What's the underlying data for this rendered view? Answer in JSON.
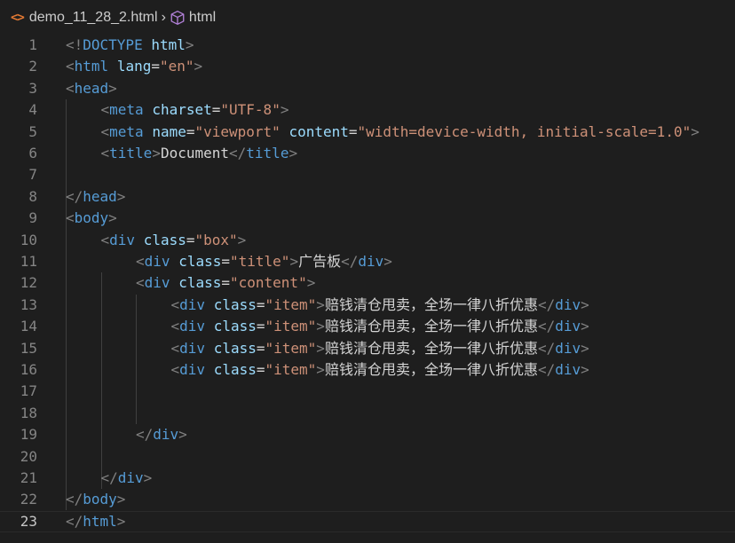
{
  "breadcrumb": {
    "file_name": "demo_11_28_2.html",
    "node": "html",
    "file_icon_glyph": "<>",
    "separator_glyph": "›"
  },
  "editor": {
    "current_line": 23,
    "lines": [
      {
        "n": "1",
        "indent": 0,
        "tokens": [
          [
            "punct",
            "<!"
          ],
          [
            "doctype",
            "DOCTYPE"
          ],
          [
            "text",
            " "
          ],
          [
            "doctype-name",
            "html"
          ],
          [
            "punct",
            ">"
          ]
        ]
      },
      {
        "n": "2",
        "indent": 0,
        "tokens": [
          [
            "punct",
            "<"
          ],
          [
            "tag",
            "html"
          ],
          [
            "text",
            " "
          ],
          [
            "attr",
            "lang"
          ],
          [
            "eq",
            "="
          ],
          [
            "str",
            "\"en\""
          ],
          [
            "punct",
            ">"
          ]
        ]
      },
      {
        "n": "3",
        "indent": 0,
        "tokens": [
          [
            "punct",
            "<"
          ],
          [
            "tag",
            "head"
          ],
          [
            "punct",
            ">"
          ]
        ]
      },
      {
        "n": "4",
        "indent": 1,
        "tokens": [
          [
            "punct",
            "<"
          ],
          [
            "tag",
            "meta"
          ],
          [
            "text",
            " "
          ],
          [
            "attr",
            "charset"
          ],
          [
            "eq",
            "="
          ],
          [
            "str",
            "\"UTF-8\""
          ],
          [
            "punct",
            ">"
          ]
        ]
      },
      {
        "n": "5",
        "indent": 1,
        "tokens": [
          [
            "punct",
            "<"
          ],
          [
            "tag",
            "meta"
          ],
          [
            "text",
            " "
          ],
          [
            "attr",
            "name"
          ],
          [
            "eq",
            "="
          ],
          [
            "str",
            "\"viewport\""
          ],
          [
            "text",
            " "
          ],
          [
            "attr",
            "content"
          ],
          [
            "eq",
            "="
          ],
          [
            "str",
            "\"width=device-width, initial-scale=1.0\""
          ],
          [
            "punct",
            ">"
          ]
        ]
      },
      {
        "n": "6",
        "indent": 1,
        "tokens": [
          [
            "punct",
            "<"
          ],
          [
            "tag",
            "title"
          ],
          [
            "punct",
            ">"
          ],
          [
            "text",
            "Document"
          ],
          [
            "punct",
            "</"
          ],
          [
            "tag",
            "title"
          ],
          [
            "punct",
            ">"
          ]
        ]
      },
      {
        "n": "7",
        "indent": 0,
        "tokens": []
      },
      {
        "n": "8",
        "indent": 0,
        "tokens": [
          [
            "punct",
            "</"
          ],
          [
            "tag",
            "head"
          ],
          [
            "punct",
            ">"
          ]
        ]
      },
      {
        "n": "9",
        "indent": 0,
        "tokens": [
          [
            "punct",
            "<"
          ],
          [
            "tag",
            "body"
          ],
          [
            "punct",
            ">"
          ]
        ]
      },
      {
        "n": "10",
        "indent": 1,
        "tokens": [
          [
            "punct",
            "<"
          ],
          [
            "tag",
            "div"
          ],
          [
            "text",
            " "
          ],
          [
            "attr",
            "class"
          ],
          [
            "eq",
            "="
          ],
          [
            "str",
            "\"box\""
          ],
          [
            "punct",
            ">"
          ]
        ]
      },
      {
        "n": "11",
        "indent": 2,
        "tokens": [
          [
            "punct",
            "<"
          ],
          [
            "tag",
            "div"
          ],
          [
            "text",
            " "
          ],
          [
            "attr",
            "class"
          ],
          [
            "eq",
            "="
          ],
          [
            "str",
            "\"title\""
          ],
          [
            "punct",
            ">"
          ],
          [
            "text",
            "广告板"
          ],
          [
            "punct",
            "</"
          ],
          [
            "tag",
            "div"
          ],
          [
            "punct",
            ">"
          ]
        ]
      },
      {
        "n": "12",
        "indent": 2,
        "tokens": [
          [
            "punct",
            "<"
          ],
          [
            "tag",
            "div"
          ],
          [
            "text",
            " "
          ],
          [
            "attr",
            "class"
          ],
          [
            "eq",
            "="
          ],
          [
            "str",
            "\"content\""
          ],
          [
            "punct",
            ">"
          ]
        ]
      },
      {
        "n": "13",
        "indent": 3,
        "tokens": [
          [
            "punct",
            "<"
          ],
          [
            "tag",
            "div"
          ],
          [
            "text",
            " "
          ],
          [
            "attr",
            "class"
          ],
          [
            "eq",
            "="
          ],
          [
            "str",
            "\"item\""
          ],
          [
            "punct",
            ">"
          ],
          [
            "text",
            "赔钱清仓甩卖，全场一律八折优惠"
          ],
          [
            "punct",
            "</"
          ],
          [
            "tag",
            "div"
          ],
          [
            "punct",
            ">"
          ]
        ]
      },
      {
        "n": "14",
        "indent": 3,
        "tokens": [
          [
            "punct",
            "<"
          ],
          [
            "tag",
            "div"
          ],
          [
            "text",
            " "
          ],
          [
            "attr",
            "class"
          ],
          [
            "eq",
            "="
          ],
          [
            "str",
            "\"item\""
          ],
          [
            "punct",
            ">"
          ],
          [
            "text",
            "赔钱清仓甩卖，全场一律八折优惠"
          ],
          [
            "punct",
            "</"
          ],
          [
            "tag",
            "div"
          ],
          [
            "punct",
            ">"
          ]
        ]
      },
      {
        "n": "15",
        "indent": 3,
        "tokens": [
          [
            "punct",
            "<"
          ],
          [
            "tag",
            "div"
          ],
          [
            "text",
            " "
          ],
          [
            "attr",
            "class"
          ],
          [
            "eq",
            "="
          ],
          [
            "str",
            "\"item\""
          ],
          [
            "punct",
            ">"
          ],
          [
            "text",
            "赔钱清仓甩卖，全场一律八折优惠"
          ],
          [
            "punct",
            "</"
          ],
          [
            "tag",
            "div"
          ],
          [
            "punct",
            ">"
          ]
        ]
      },
      {
        "n": "16",
        "indent": 3,
        "tokens": [
          [
            "punct",
            "<"
          ],
          [
            "tag",
            "div"
          ],
          [
            "text",
            " "
          ],
          [
            "attr",
            "class"
          ],
          [
            "eq",
            "="
          ],
          [
            "str",
            "\"item\""
          ],
          [
            "punct",
            ">"
          ],
          [
            "text",
            "赔钱清仓甩卖，全场一律八折优惠"
          ],
          [
            "punct",
            "</"
          ],
          [
            "tag",
            "div"
          ],
          [
            "punct",
            ">"
          ]
        ]
      },
      {
        "n": "17",
        "indent": 0,
        "tokens": []
      },
      {
        "n": "18",
        "indent": 0,
        "tokens": []
      },
      {
        "n": "19",
        "indent": 2,
        "tokens": [
          [
            "punct",
            "</"
          ],
          [
            "tag",
            "div"
          ],
          [
            "punct",
            ">"
          ]
        ]
      },
      {
        "n": "20",
        "indent": 0,
        "tokens": []
      },
      {
        "n": "21",
        "indent": 1,
        "tokens": [
          [
            "punct",
            "</"
          ],
          [
            "tag",
            "div"
          ],
          [
            "punct",
            ">"
          ]
        ]
      },
      {
        "n": "22",
        "indent": 0,
        "tokens": [
          [
            "punct",
            "</"
          ],
          [
            "tag",
            "body"
          ],
          [
            "punct",
            ">"
          ]
        ]
      },
      {
        "n": "23",
        "indent": 0,
        "tokens": [
          [
            "punct",
            "</"
          ],
          [
            "tag",
            "html"
          ],
          [
            "punct",
            ">"
          ]
        ]
      }
    ]
  },
  "colors": {
    "background": "#1e1e1e",
    "tag": "#569cd6",
    "attribute": "#9cdcfe",
    "string": "#ce9178",
    "punctuation": "#808080",
    "text": "#d4d4d4",
    "line_number": "#858585",
    "file_icon": "#e37933"
  }
}
